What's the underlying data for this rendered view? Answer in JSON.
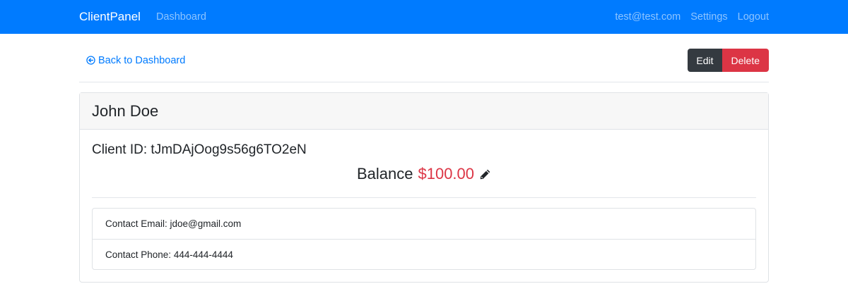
{
  "navbar": {
    "brand": "ClientPanel",
    "dashboard_link": "Dashboard",
    "user_email": "test@test.com",
    "settings_link": "Settings",
    "logout_link": "Logout",
    "background_color": "#007bff"
  },
  "toolbar": {
    "back_link_label": "Back to Dashboard",
    "back_icon": "arrow-circle-left-icon",
    "edit_label": "Edit",
    "delete_label": "Delete",
    "edit_color": "#343a40",
    "delete_color": "#dc3545"
  },
  "client": {
    "name": "John Doe",
    "client_id_text": "Client ID: tJmDAjOog9s56g6TO2eN",
    "balance_label": "Balance",
    "balance_value": "$100.00",
    "edit_balance_icon": "pencil-icon",
    "contact_email_text": "Contact Email: jdoe@gmail.com",
    "contact_phone_text": "Contact Phone: 444-444-4444"
  }
}
